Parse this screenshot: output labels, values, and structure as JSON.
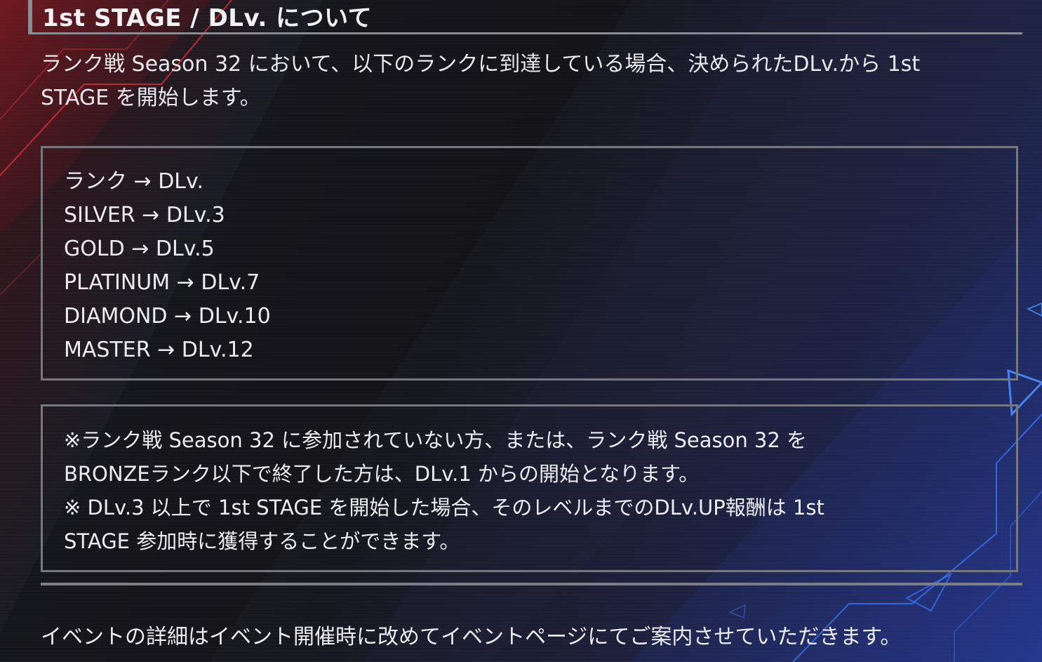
{
  "section": {
    "heading": "1st STAGE / DLv. について",
    "intro_lines": [
      "ランク戦 Season 32 において、以下のランクに到達している場合、決められたDLv.から 1st",
      "STAGE を開始します。"
    ]
  },
  "rank_table": {
    "lines": [
      "ランク → DLv.",
      "SILVER → DLv.3",
      "GOLD → DLv.5",
      "PLATINUM → DLv.7",
      "DIAMOND → DLv.10",
      "MASTER → DLv.12"
    ]
  },
  "notes": {
    "lines": [
      "※ランク戦 Season 32 に参加されていない方、または、ランク戦 Season 32 を",
      "BRONZEランク以下で終了した方は、DLv.1 からの開始となります。",
      "※ DLv.3 以上で 1st STAGE を開始した場合、そのレベルまでのDLv.UP報酬は 1st",
      "STAGE 参加時に獲得することができます。"
    ]
  },
  "footer": {
    "text": "イベントの詳細はイベント開催時に改めてイベントページにてご案内させていただきます。"
  },
  "colors": {
    "rule": "#8b8b93",
    "box_border": "#77777f",
    "accent_red": "#e0303a",
    "accent_blue": "#3a7bff"
  }
}
